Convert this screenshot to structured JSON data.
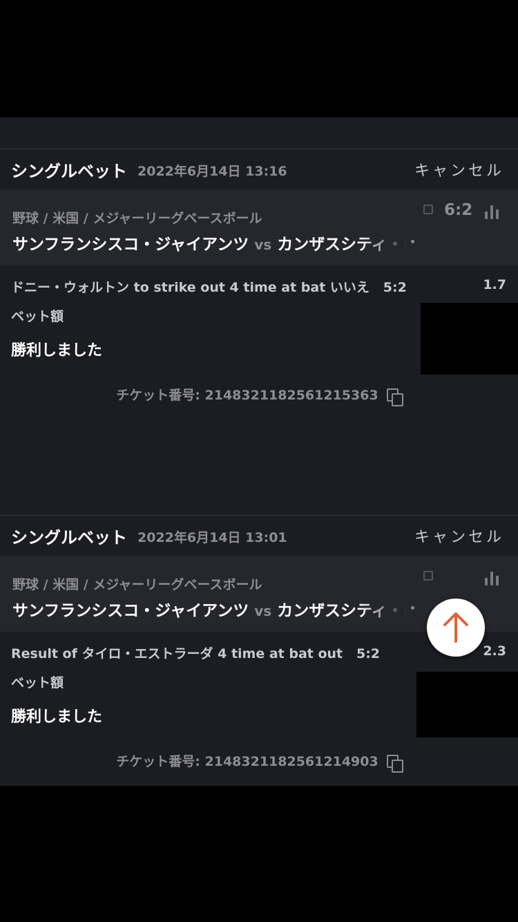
{
  "bets": [
    {
      "type_label": "シングルベット",
      "datetime": "2022年6月14日 13:16",
      "cancel_label": "キャンセル",
      "breadcrumb": "野球 / 米国 / メジャーリーグベースボール",
      "home_team": "サンフランシスコ・ジャイアンツ",
      "vs_label": "vs",
      "away_team": "カンザスシティ・ロイヤルズ",
      "score": "6:2",
      "selection": "ドニー・ウォルトン to strike out 4 time at bat いいえ   5:2",
      "odds": "1.7",
      "stake_label": "ベット額",
      "result": "勝利しました",
      "ticket_label": "チケット番号: 2148321182561215363"
    },
    {
      "type_label": "シングルベット",
      "datetime": "2022年6月14日 13:01",
      "cancel_label": "キャンセル",
      "breadcrumb": "野球 / 米国 / メジャーリーグベースボール",
      "home_team": "サンフランシスコ・ジャイアンツ",
      "vs_label": "vs",
      "away_team": "カンザスシティ・ロイヤルズ",
      "score": "",
      "selection": "Result of タイロ・エストラーダ 4 time at bat out   5:2",
      "odds": "2.3",
      "stake_label": "ベット額",
      "result": "勝利しました",
      "ticket_label": "チケット番号: 2148321182561214903"
    }
  ],
  "icons": {
    "scroll_top": "arrow-up-icon",
    "copy": "copy-icon",
    "stats": "bar-chart-icon",
    "chat": "chat-icon"
  },
  "colors": {
    "accent": "#e0643f",
    "card_bg": "#1c1d22",
    "event_bg": "#26272d",
    "muted_text": "#8d8e93"
  }
}
